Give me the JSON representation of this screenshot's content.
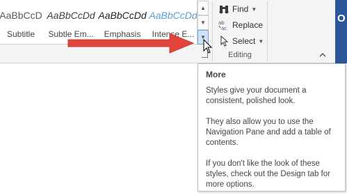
{
  "styles_gallery": {
    "items": [
      {
        "preview": "AaBbCcD",
        "name": "Subtitle",
        "preview_color": "#595959",
        "italic": false
      },
      {
        "preview": "AaBbCcDd",
        "name": "Subtle Em...",
        "preview_color": "#404040",
        "italic": true
      },
      {
        "preview": "AaBbCcDd",
        "name": "Emphasis",
        "preview_color": "#222222",
        "italic": true
      },
      {
        "preview": "AaBbCcDd",
        "name": "Intense E...",
        "preview_color": "#5b9bd5",
        "italic": true
      }
    ],
    "more_button_label": "▼"
  },
  "editing": {
    "find": "Find",
    "replace": "Replace",
    "select": "Select",
    "label": "Editing"
  },
  "tab_fragment": "O",
  "tooltip": {
    "title": "More",
    "paragraphs": [
      "Styles give your document a consistent, polished look.",
      "They also allow you to use the Navigation Pane and add a table of contents.",
      "If you don't like the look of these styles, check out the Design tab for more options."
    ]
  },
  "colors": {
    "annotation_arrow": "#e0443a",
    "ribbon_blue": "#2b579a",
    "more_button_highlight": "#cfe3f8"
  }
}
